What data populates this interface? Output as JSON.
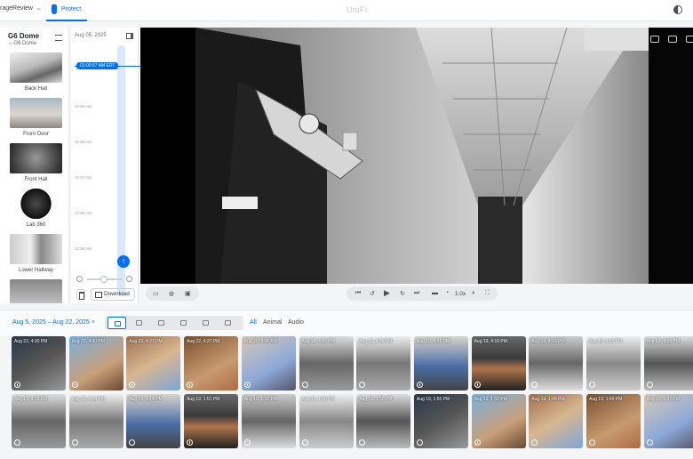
{
  "topbar": {
    "app_name": "rageReview",
    "tab_label": "Protect",
    "brand": "UniFi"
  },
  "colors": {
    "accent": "#006fff",
    "panel": "#ffffff",
    "bg": "#f4f5f6"
  },
  "camera_panel": {
    "title": "G6 Dome",
    "subtitle": "G6 Dome",
    "cameras": [
      {
        "name": "Back Hall"
      },
      {
        "name": "Front Door"
      },
      {
        "name": "Front Hall"
      },
      {
        "name": "Lab 360"
      },
      {
        "name": "Lower Hallway"
      },
      {
        "name": ""
      }
    ]
  },
  "timeline": {
    "date": "Aug 05, 2025",
    "current_time": "01:00:07 AM EDT",
    "ticks": [
      "12:59 AM",
      "12:58 AM",
      "12:57 AM",
      "12:56 AM",
      "12:55 AM"
    ],
    "download_label": "Download"
  },
  "player": {
    "playback_rate": "1.0x"
  },
  "filters": {
    "date_range": "Aug 5, 2025 – Aug 22, 2025",
    "clear": "×",
    "categories": [
      "All",
      "Animal",
      "Audio"
    ]
  },
  "events": [
    {
      "time": "Aug 22, 4:30 PM",
      "type": "person"
    },
    {
      "time": "Aug 22, 4:30 PM",
      "type": "person"
    },
    {
      "time": "Aug 22, 4:27 PM",
      "type": "person"
    },
    {
      "time": "Aug 22, 4:27 PM",
      "type": "person"
    },
    {
      "time": "Aug 20, 9:41 AM",
      "type": "person"
    },
    {
      "time": "Aug 19, 4:59 PM",
      "type": "face"
    },
    {
      "time": "Aug 19, 4:59 PM",
      "type": "face"
    },
    {
      "time": "Aug 19, 4:16 PM",
      "type": "person"
    },
    {
      "time": "Aug 19, 4:16 PM",
      "type": "person"
    },
    {
      "time": "Aug 19, 4:16 PM",
      "type": "face"
    },
    {
      "time": "Aug 19, 4:15 PM",
      "type": "face"
    },
    {
      "time": "Aug 19, 4:15 PM",
      "type": "face"
    },
    {
      "time": "Aug 19, 4:15 PM",
      "type": "face"
    },
    {
      "time": "Aug 19, 4:14 PM",
      "type": "face"
    },
    {
      "time": "Aug 19, 4:14 PM",
      "type": "face"
    },
    {
      "time": "Aug 19, 1:51 PM",
      "type": "person"
    },
    {
      "time": "Aug 19, 1:51 PM",
      "type": "face"
    },
    {
      "time": "Aug 19, 1:50 PM",
      "type": "face"
    },
    {
      "time": "Aug 19, 1:50 PM",
      "type": "face"
    },
    {
      "time": "Aug 19, 1:50 PM",
      "type": "face"
    },
    {
      "time": "Aug 19, 1:50 PM",
      "type": "person"
    },
    {
      "time": "Aug 19, 1:49 PM",
      "type": "face"
    },
    {
      "time": "Aug 19, 1:49 PM",
      "type": "face"
    },
    {
      "time": "Aug 19, 1:47 PM",
      "type": "face"
    }
  ]
}
